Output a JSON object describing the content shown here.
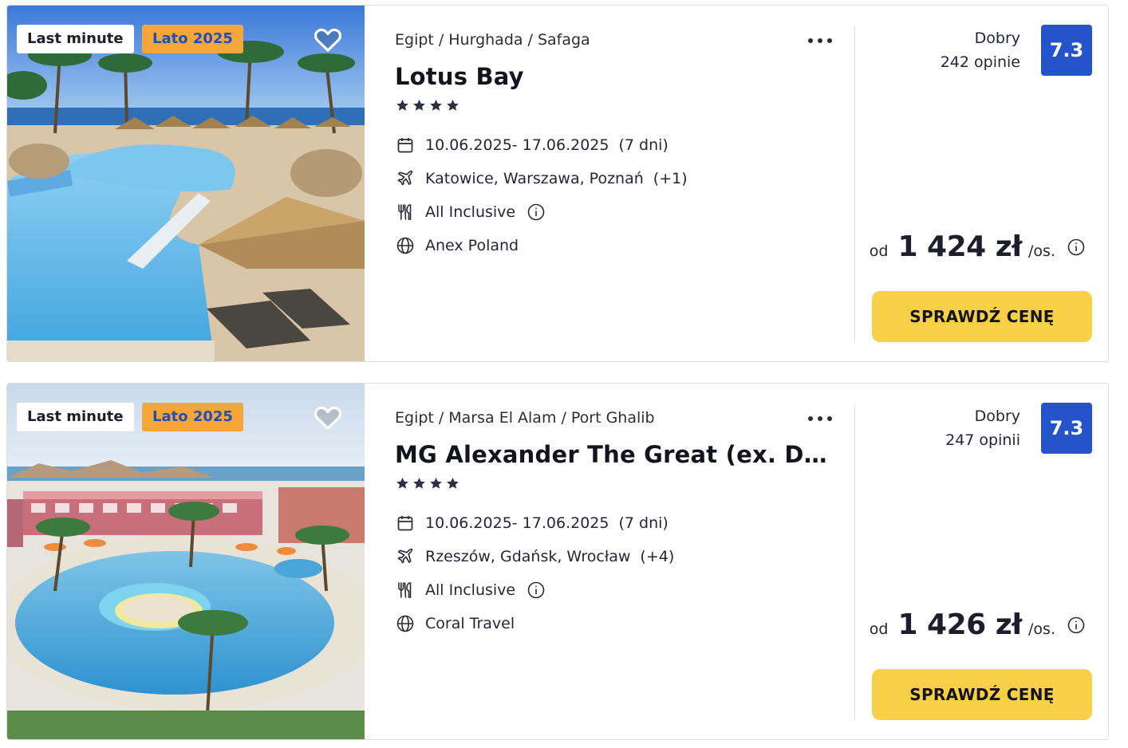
{
  "offers": [
    {
      "badges": {
        "last_minute": "Last minute",
        "season": "Lato 2025"
      },
      "breadcrumb": {
        "country": "Egipt",
        "region": "Hurghada",
        "city": "Safaga",
        "sep": "/"
      },
      "name": "Lotus Bay",
      "stars": 4,
      "dates": "10.06.2025- 17.06.2025",
      "duration": "(7 dni)",
      "departures": "Katowice, Warszawa, Poznań",
      "departures_extra": "(+1)",
      "board": "All Inclusive",
      "operator": "Anex Poland",
      "rating_word": "Dobry",
      "reviews": "242 opinie",
      "score": "7.3",
      "price_prefix": "od",
      "price": "1 424 zł",
      "price_suffix": "/os.",
      "cta": "SPRAWDŹ CENĘ"
    },
    {
      "badges": {
        "last_minute": "Last minute",
        "season": "Lato 2025"
      },
      "breadcrumb": {
        "country": "Egipt",
        "region": "Marsa El Alam",
        "city": "Port Ghalib",
        "sep": "/"
      },
      "name": "MG Alexander The Great (ex. Dessole",
      "stars": 4,
      "dates": "10.06.2025- 17.06.2025",
      "duration": "(7 dni)",
      "departures": "Rzeszów, Gdańsk, Wrocław",
      "departures_extra": "(+4)",
      "board": "All Inclusive",
      "operator": "Coral Travel",
      "rating_word": "Dobry",
      "reviews": "247 opinii",
      "score": "7.3",
      "price_prefix": "od",
      "price": "1 426 zł",
      "price_suffix": "/os.",
      "cta": "SPRAWDŹ CENĘ"
    }
  ],
  "icons": {
    "favorite": "heart-outline-icon",
    "more": "more-dots-icon",
    "star": "star-icon",
    "dates": "calendar-icon",
    "departures": "plane-icon",
    "board": "fork-knife-icon",
    "info": "info-circle-icon",
    "operator": "globe-icon"
  },
  "colors": {
    "cta": "#f7d047",
    "score": "#2553c9",
    "season_badge": "#f4a63b",
    "season_text": "#1f4fb9",
    "star": "#2b3043"
  }
}
